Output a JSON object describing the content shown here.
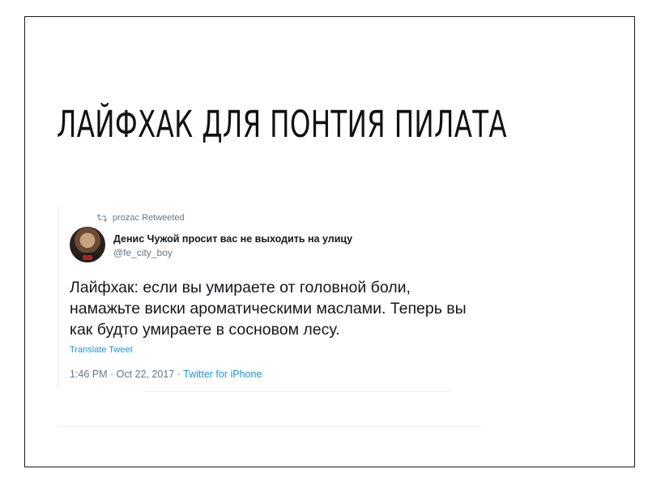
{
  "slide": {
    "title": "ЛАЙФХАК ДЛЯ ПОНТИЯ ПИЛАТА"
  },
  "tweet": {
    "retweeted_by": "prozac Retweeted",
    "author_name": "Денис Чужой просит вас не выходить на улицу",
    "author_handle": "@fe_city_boy",
    "text": "Лайфхак: если вы умираете от головной боли, намажьте виски ароматическими маслами. Теперь вы как будто умираете в сосновом лесу.",
    "translate_label": "Translate Tweet",
    "timestamp": "1:46 PM · Oct 22, 2017 · ",
    "source": "Twitter for iPhone"
  },
  "colors": {
    "link": "#1b95e0",
    "muted": "#657786",
    "text": "#14171a"
  },
  "icons": {
    "retweet": "retweet-icon",
    "avatar": "avatar"
  }
}
